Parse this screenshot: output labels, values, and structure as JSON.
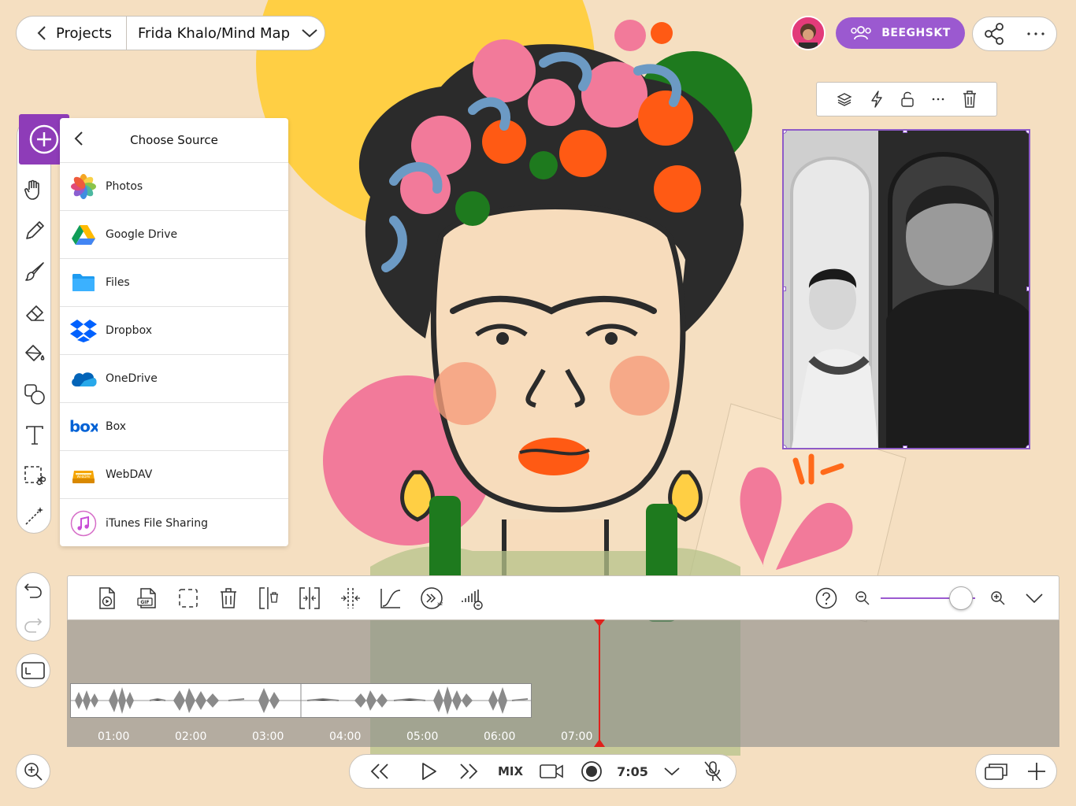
{
  "nav": {
    "back_label": "Projects",
    "project_title": "Frida Khalo/Mind Map"
  },
  "collab": {
    "label": "BEEGHSKT"
  },
  "source_panel": {
    "title": "Choose Source",
    "items": [
      {
        "label": "Photos",
        "icon": "photos-icon"
      },
      {
        "label": "Google Drive",
        "icon": "google-drive-icon"
      },
      {
        "label": "Files",
        "icon": "files-icon"
      },
      {
        "label": "Dropbox",
        "icon": "dropbox-icon"
      },
      {
        "label": "OneDrive",
        "icon": "onedrive-icon"
      },
      {
        "label": "Box",
        "icon": "box-icon"
      },
      {
        "label": "WebDAV",
        "icon": "webdav-icon"
      },
      {
        "label": "iTunes File Sharing",
        "icon": "itunes-icon"
      }
    ]
  },
  "timeline": {
    "ticks": [
      "01:00",
      "02:00",
      "03:00",
      "04:00",
      "05:00",
      "06:00",
      "07:00"
    ],
    "zoom_level": 0.85
  },
  "playbar": {
    "mix_label": "MIX",
    "time": "7:05"
  },
  "colors": {
    "accent": "#9b59d0",
    "playhead": "#e0201c",
    "background": "#f5dfc1"
  }
}
